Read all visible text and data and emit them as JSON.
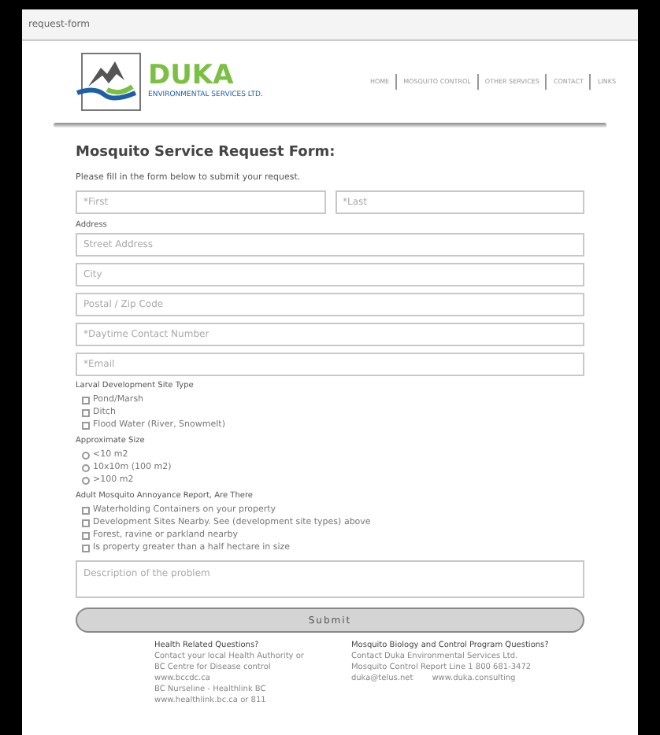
{
  "tab": {
    "title": "request-form"
  },
  "logo": {
    "name": "DUKA",
    "tagline": "ENVIRONMENTAL SERVICES LTD."
  },
  "nav": [
    "HOME",
    "MOSQUITO CONTROL",
    "OTHER SERVICES",
    "CONTACT",
    "LINKS"
  ],
  "form": {
    "title": "Mosquito Service Request Form:",
    "intro": "Please fill in the form below to submit your request.",
    "name_fields": [
      {
        "placeholder": "*First"
      },
      {
        "placeholder": "*Last"
      }
    ],
    "address_label": "Address",
    "fields": [
      {
        "placeholder": "Street Address"
      },
      {
        "placeholder": "City"
      },
      {
        "placeholder": "Postal / Zip Code"
      },
      {
        "placeholder": "*Daytime Contact Number"
      },
      {
        "placeholder": "*Email"
      }
    ],
    "groups": [
      {
        "label": "Larval Development Site Type",
        "options": [
          {
            "kind": "checkbox",
            "label": "Pond/Marsh",
            "checked": false
          },
          {
            "kind": "checkbox",
            "label": "Ditch",
            "checked": false
          },
          {
            "kind": "checkbox",
            "label": "Flood Water (River, Snowmelt)",
            "checked": false
          }
        ]
      },
      {
        "label": "Approximate Size",
        "options": [
          {
            "kind": "radio",
            "label": "<10 m2",
            "checked": false
          },
          {
            "kind": "radio",
            "label": "10x10m (100 m2)",
            "checked": false
          },
          {
            "kind": "radio",
            "label": ">100 m2",
            "checked": false
          }
        ]
      },
      {
        "label": "Adult Mosquito Annoyance Report, Are There",
        "options": [
          {
            "kind": "checkbox",
            "label": "Waterholding Containers on your property",
            "checked": false
          },
          {
            "kind": "checkbox",
            "label": "Development Sites Nearby. See (development site types) above",
            "checked": false
          },
          {
            "kind": "checkbox",
            "label": "Forest, ravine or parkland nearby",
            "checked": false
          },
          {
            "kind": "checkbox",
            "label": "Is property greater than a half hectare in size",
            "checked": false
          }
        ]
      }
    ],
    "description": {
      "placeholder": "Description of the problem"
    },
    "submit": "Submit"
  },
  "footer": [
    {
      "heading": "Health Related Questions?",
      "lines": [
        [
          "Contact your local Health Authority or"
        ],
        [
          "BC Centre for Disease control"
        ],
        [
          "www.bccdc.ca"
        ],
        [
          "BC Nurseline - Healthlink BC"
        ],
        [
          "www.healthlink.bc.ca or 811"
        ]
      ]
    },
    {
      "heading": "Mosquito Biology and Control Program Questions?",
      "lines": [
        [
          "Contact Duka Environmental Services Ltd."
        ],
        [
          "Mosquito Control Report Line 1 800 681-3472"
        ],
        [
          "duka@telus.net",
          "www.duka.consulting"
        ]
      ]
    }
  ]
}
